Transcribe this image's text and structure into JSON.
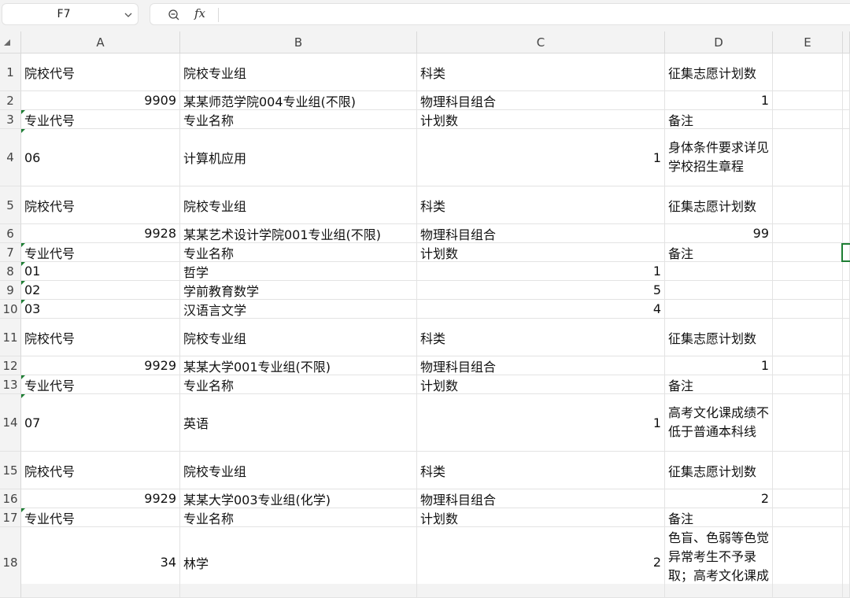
{
  "name_box": "F7",
  "formula": {
    "fx_label": "fx",
    "value": ""
  },
  "columns": [
    "A",
    "B",
    "C",
    "D",
    "E"
  ],
  "rows": [
    {
      "num": "1",
      "cells": [
        "院校代号",
        "院校专业组",
        "科类",
        "征集志愿计划数",
        ""
      ]
    },
    {
      "num": "2",
      "cells": [
        "9909",
        "某某师范学院004专业组(不限)",
        "物理科目组合",
        "1",
        ""
      ]
    },
    {
      "num": "3",
      "cells": [
        "专业代号",
        "专业名称",
        "计划数",
        "备注",
        ""
      ]
    },
    {
      "num": "4",
      "cells": [
        "06",
        "计算机应用",
        "1",
        "身体条件要求详见学校招生章程",
        ""
      ]
    },
    {
      "num": "5",
      "cells": [
        "院校代号",
        "院校专业组",
        "科类",
        "征集志愿计划数",
        ""
      ]
    },
    {
      "num": "6",
      "cells": [
        "9928",
        "某某艺术设计学院001专业组(不限)",
        "物理科目组合",
        "99",
        ""
      ]
    },
    {
      "num": "7",
      "cells": [
        "专业代号",
        "专业名称",
        "计划数",
        "备注",
        ""
      ]
    },
    {
      "num": "8",
      "cells": [
        "01",
        "哲学",
        "1",
        "",
        ""
      ]
    },
    {
      "num": "9",
      "cells": [
        "02",
        "学前教育数学",
        "5",
        "",
        ""
      ]
    },
    {
      "num": "10",
      "cells": [
        "03",
        "汉语言文学",
        "4",
        "",
        ""
      ]
    },
    {
      "num": "11",
      "cells": [
        "院校代号",
        "院校专业组",
        "科类",
        "征集志愿计划数",
        ""
      ]
    },
    {
      "num": "12",
      "cells": [
        "9929",
        "某某大学001专业组(不限)",
        "物理科目组合",
        "1",
        ""
      ]
    },
    {
      "num": "13",
      "cells": [
        "专业代号",
        "专业名称",
        "计划数",
        "备注",
        ""
      ]
    },
    {
      "num": "14",
      "cells": [
        "07",
        "英语",
        "1",
        "高考文化课成绩不低于普通本科线",
        ""
      ]
    },
    {
      "num": "15",
      "cells": [
        "院校代号",
        "院校专业组",
        "科类",
        "征集志愿计划数",
        ""
      ]
    },
    {
      "num": "16",
      "cells": [
        "9929",
        "某某大学003专业组(化学)",
        "物理科目组合",
        "2",
        ""
      ]
    },
    {
      "num": "17",
      "cells": [
        "专业代号",
        "专业名称",
        "计划数",
        "备注",
        ""
      ]
    },
    {
      "num": "18",
      "cells": [
        "34",
        "林学",
        "2",
        "色盲、色弱等色觉异常考生不予录取；高考文化课成",
        ""
      ]
    }
  ],
  "icons": {
    "name_box_dropdown": "chevron-down-icon",
    "zoom": "zoom-icon"
  },
  "colors": {
    "selection": "#1e7e34",
    "header_bg": "#f3f3f3",
    "grid_line": "#e3e3e3"
  }
}
